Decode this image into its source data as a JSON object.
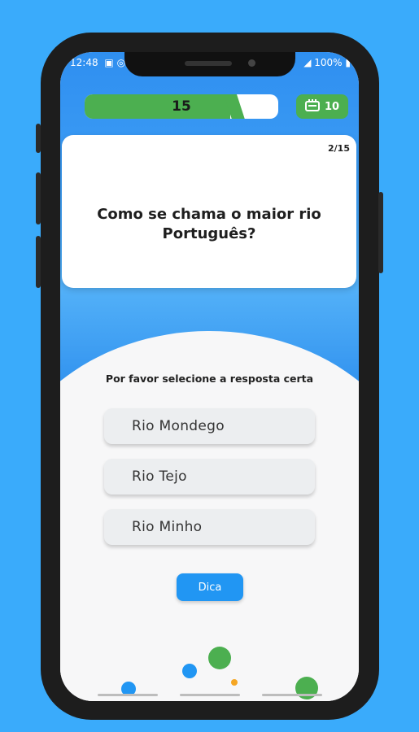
{
  "status_bar": {
    "time": "12:48",
    "battery": "100%"
  },
  "score": {
    "value": "15",
    "progress_fraction": 0.75
  },
  "coins": {
    "value": "10",
    "icon": "ticket-icon"
  },
  "question": {
    "counter": "2/15",
    "text": "Como se chama o maior rio Português?"
  },
  "prompt": "Por favor selecione a resposta certa",
  "answers": [
    "Rio Mondego",
    "Rio Tejo",
    "Rio Minho"
  ],
  "hint_label": "Dica",
  "colors": {
    "background": "#3aabfb",
    "green": "#4caf50",
    "blue": "#2196f3",
    "orange": "#f5a623"
  }
}
